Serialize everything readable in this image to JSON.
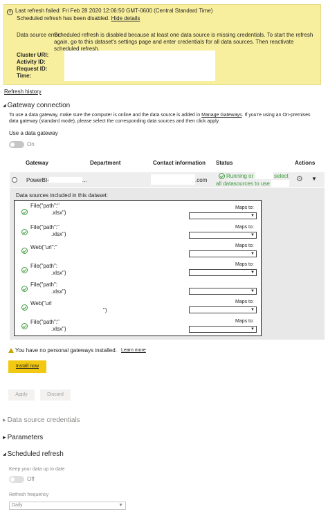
{
  "banner": {
    "last_refresh": "Last refresh failed: Fri Feb 28 2020 12:06:50 GMT-0600 (Central Standard Time)",
    "disabled_text": "Scheduled refresh has been disabled.",
    "hide_details": "Hide details",
    "error_label": "Data source error:",
    "error_message": "Scheduled refresh is disabled because at least one data source is missing credentials. To start the refresh again, go to this dataset's settings page and enter credentials for all data sources. Then reactivate scheduled refresh.",
    "cluster_uri": "Cluster URI:",
    "activity_id": "Activity ID:",
    "request_id": "Request ID:",
    "time": "Time:"
  },
  "refresh_history": "Refresh history",
  "gateway": {
    "section_title": "Gateway connection",
    "description_1": "To use a data gateway, make sure the computer is online and the data source is added in",
    "manage_gateways": "Manage Gateways",
    "description_2": ". If you're using an On-premises data gateway (standard mode), please select the corresponding data sources and then click apply.",
    "use_gateway_label": "Use a data gateway",
    "toggle_state": "On",
    "columns": {
      "gateway": "Gateway",
      "department": "Department",
      "contact": "Contact information",
      "status": "Status",
      "actions": "Actions"
    },
    "row": {
      "gateway": "PowerBI-",
      "department": "...",
      "contact": ".com",
      "status_running": "Running or",
      "status_all": "all datasources to use",
      "select": "select"
    }
  },
  "datasources": {
    "title": "Data sources included in this dataset:",
    "maps_to": "Maps to:",
    "items": [
      {
        "line1": "File(\"path\":\"",
        "line2": ".xlsx\")"
      },
      {
        "line1": "File(\"path\":\"",
        "line2": ".xlsx\")"
      },
      {
        "line1": "Web(\"url\":\"",
        "line2": ""
      },
      {
        "line1": "File(\"path\":",
        "line2": ".xlsx\")"
      },
      {
        "line1": "File(\"path\":",
        "line2": ".xlsx\")"
      },
      {
        "line1": "Web(\"url",
        "line2": "\")"
      },
      {
        "line1": "File(\"path\":\"",
        "line2": ".xlsx\")"
      }
    ]
  },
  "personal_gateway": {
    "message": "You have no personal gateways installed.",
    "learn_more": "Learn more",
    "install_button": "Install now"
  },
  "actions": {
    "apply": "Apply",
    "discard": "Discard"
  },
  "sections": {
    "credentials": "Data source credentials",
    "parameters": "Parameters",
    "scheduled_refresh": "Scheduled refresh"
  },
  "schedule": {
    "keep_up_to_date": "Keep your data up to date",
    "toggle_state": "Off",
    "frequency_label": "Refresh frequency",
    "frequency_value": "Daily"
  },
  "colors": {
    "banner_bg": "#f8ef9e",
    "accent_yellow": "#f2c811",
    "success_green": "#3a9a3a"
  }
}
